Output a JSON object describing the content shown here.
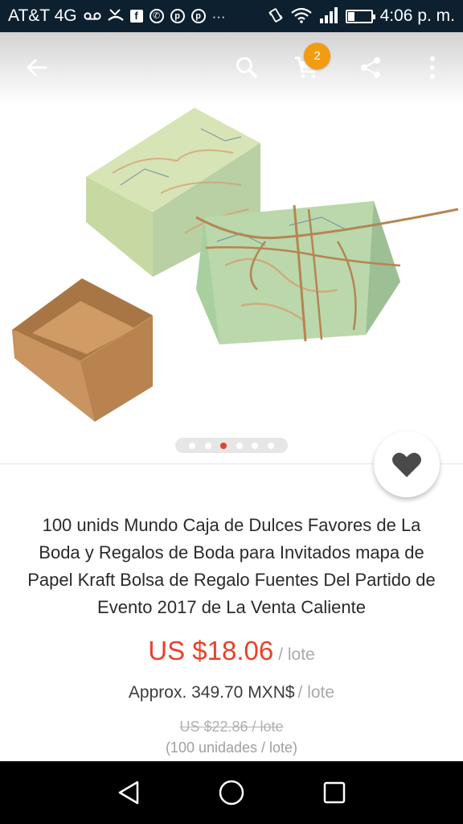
{
  "status_bar": {
    "carrier": "AT&T 4G",
    "time": "4:06 p. m.",
    "left_icons": [
      "voicemail-icon",
      "missed-call-icon",
      "facebook-icon",
      "whatsapp-icon",
      "pinterest-icon",
      "pinterest-icon",
      "more-notifications-icon"
    ],
    "right_icons": [
      "vibrate-icon",
      "wifi-icon",
      "signal-icon",
      "battery-icon"
    ],
    "more_notifications": "···"
  },
  "toolbar": {
    "icons": [
      "back-arrow-icon",
      "search-icon",
      "cart-icon",
      "share-icon",
      "more-vert-icon"
    ],
    "cart_count": "2",
    "badge_color": "#f39c12"
  },
  "carousel": {
    "total": 6,
    "active_index": 2
  },
  "product": {
    "title": "100 unids Mundo Caja de Dulces Favores de La Boda y Regalos de Boda para Invitados mapa de Papel Kraft Bolsa de Regalo Fuentes Del Partido de Evento 2017 de La Venta Caliente",
    "price": "US $18.06",
    "price_unit": "/ lote",
    "approx_price": "Approx. 349.70 MXN$",
    "approx_unit": "/ lote",
    "original_price": "US $22.86 / lote",
    "units_note": "(100 unidades / lote)",
    "price_color": "#e8412b"
  },
  "nav_bar": {
    "icons": [
      "nav-back-icon",
      "nav-home-icon",
      "nav-recent-apps-icon"
    ]
  }
}
